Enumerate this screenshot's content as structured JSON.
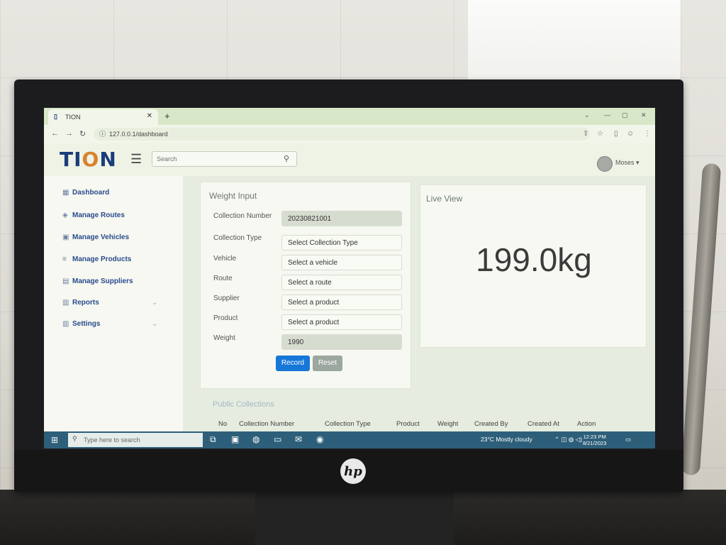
{
  "browser": {
    "tab_title": "TION",
    "url": "127.0.0.1/dashboard",
    "icons": [
      "back-icon",
      "forward-icon",
      "reload-icon",
      "info-icon",
      "share-icon",
      "star-icon",
      "sidepanel-icon",
      "profile-icon",
      "menu-icon"
    ]
  },
  "header": {
    "logo_prefix": "TI",
    "logo_o": "O",
    "logo_suffix": "N",
    "search_placeholder": "Search",
    "user_name": "Moses"
  },
  "sidebar": {
    "items": [
      {
        "label": "Dashboard",
        "icon": "dashboard-icon"
      },
      {
        "label": "Manage Routes",
        "icon": "routes-icon"
      },
      {
        "label": "Manage Vehicles",
        "icon": "vehicles-icon"
      },
      {
        "label": "Manage Products",
        "icon": "products-icon"
      },
      {
        "label": "Manage Suppliers",
        "icon": "suppliers-icon"
      },
      {
        "label": "Reports",
        "icon": "reports-icon"
      },
      {
        "label": "Settings",
        "icon": "settings-icon"
      }
    ]
  },
  "weight_input": {
    "title": "Weight Input",
    "fields": [
      {
        "label": "Collection Number",
        "value": "20230821001"
      },
      {
        "label": "Collection Type",
        "value": "Select Collection Type"
      },
      {
        "label": "Vehicle",
        "value": "Select a vehicle"
      },
      {
        "label": "Route",
        "value": "Select a route"
      },
      {
        "label": "Supplier",
        "value": "Select a product"
      },
      {
        "label": "Product",
        "value": "Select a product"
      },
      {
        "label": "Weight",
        "value": "1990"
      }
    ],
    "record_label": "Record",
    "reset_label": "Reset"
  },
  "live_view": {
    "title": "Live View",
    "value": "199.0kg"
  },
  "collections": {
    "title": "Public Collections",
    "columns": [
      "No",
      "Collection Number",
      "Collection Type",
      "Product",
      "Weight",
      "Created By",
      "Created At",
      "Action"
    ]
  },
  "taskbar": {
    "search_placeholder": "Type here to search",
    "weather": "23°C  Mostly cloudy",
    "time": "12:23 PM",
    "date": "8/21/2023"
  },
  "colors": {
    "accent": "#1677d9",
    "brand": "#1a3d7a",
    "brand_o": "#d9822b",
    "reset": "#9ca79f"
  }
}
